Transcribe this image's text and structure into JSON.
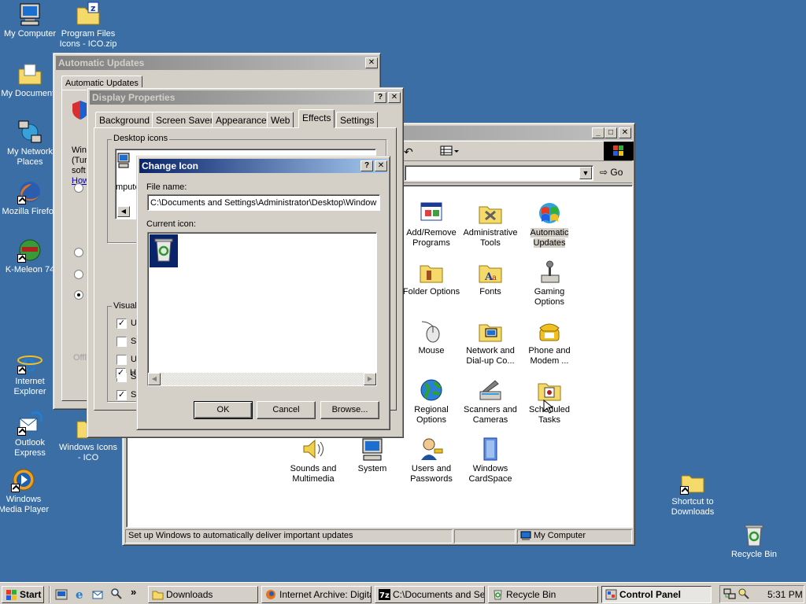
{
  "desktop": {
    "icons": [
      {
        "label": "My Computer"
      },
      {
        "label": "Program Files Icons - ICO.zip"
      },
      {
        "label": "My Documents"
      },
      {
        "label": "My Network Places"
      },
      {
        "label": "Mozilla Firefox"
      },
      {
        "label": "K-Meleon 74"
      },
      {
        "label": "Internet Explorer"
      },
      {
        "label": "Outlook Express"
      },
      {
        "label": "Windows Media Player"
      },
      {
        "label": "Windows Icons - ICO"
      },
      {
        "label": "Shortcut to Downloads"
      },
      {
        "label": "Recycle Bin"
      }
    ]
  },
  "auto_updates_window": {
    "title": "Automatic Updates",
    "tab": "Automatic Updates",
    "text_lines": [
      "Wind",
      "(Tur",
      "soft",
      "How"
    ],
    "footer": "Offl"
  },
  "display_properties": {
    "title": "Display Properties",
    "tabs": [
      "Background",
      "Screen Saver",
      "Appearance",
      "Web",
      "Effects",
      "Settings"
    ],
    "desktop_icons_group": "Desktop icons",
    "desktop_icon_fragment": "mpute",
    "visual_group": "Visual",
    "checks": [
      {
        "label": "U",
        "checked": true
      },
      {
        "label": "S",
        "checked": false
      },
      {
        "label": "U",
        "checked": false
      },
      {
        "label": "S",
        "checked": true
      },
      {
        "label": "S",
        "checked": true
      },
      {
        "label": "H",
        "checked": true
      }
    ]
  },
  "change_icon": {
    "title": "Change Icon",
    "file_name_label": "File name:",
    "file_name_value": "C:\\Documents and Settings\\Administrator\\Desktop\\Window",
    "current_icon_label": "Current icon:",
    "ok": "OK",
    "cancel": "Cancel",
    "browse": "Browse..."
  },
  "control_panel": {
    "go_label": "Go",
    "status_text": "Set up Windows to automatically deliver important updates",
    "status_zone": "My Computer",
    "items": [
      {
        "label": "Add/Remove Programs"
      },
      {
        "label": "Administrative Tools"
      },
      {
        "label": "Automatic Updates"
      },
      {
        "label": "Folder Options"
      },
      {
        "label": "Fonts"
      },
      {
        "label": "Gaming Options"
      },
      {
        "label": "Mouse"
      },
      {
        "label": "Network and Dial-up Co..."
      },
      {
        "label": "Phone and Modem ..."
      },
      {
        "label": "Regional Options"
      },
      {
        "label": "Scanners and Cameras"
      },
      {
        "label": "Scheduled Tasks"
      },
      {
        "label": "Sounds and Multimedia"
      },
      {
        "label": "System"
      },
      {
        "label": "Users and Passwords"
      },
      {
        "label": "Windows CardSpace"
      }
    ]
  },
  "taskbar": {
    "start": "Start",
    "tasks": [
      {
        "label": "Downloads"
      },
      {
        "label": "Internet Archive: Digita..."
      },
      {
        "label": "C:\\Documents and Se..."
      },
      {
        "label": "Recycle Bin"
      },
      {
        "label": "Control Panel"
      }
    ],
    "clock": "5:31 PM"
  },
  "colors": {
    "desktop": "#3a6ea5",
    "title_active": "#0a246a",
    "face": "#d4d0c8"
  }
}
